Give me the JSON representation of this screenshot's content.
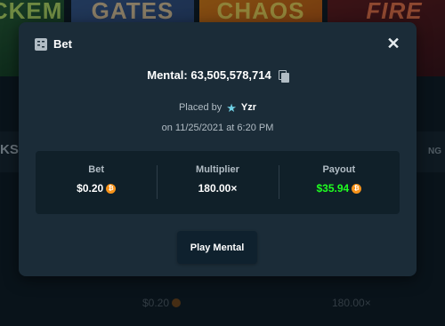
{
  "background": {
    "cards": [
      "ICKEM",
      "GATES",
      "CHAOS",
      "FIRE"
    ],
    "strip_left": "KSA",
    "strip_right": "NG",
    "bottom_row": {
      "bet": "$0.20",
      "multiplier": "180.00×"
    }
  },
  "modal": {
    "title": "Bet",
    "close_icon": "close-icon",
    "bet_id_label": "Mental: 63,505,578,714",
    "placed_by_label": "Placed by",
    "user": "Yzr",
    "date": "on 11/25/2021 at 6:20 PM",
    "stats": [
      {
        "label": "Bet",
        "value": "$0.20",
        "coin": true
      },
      {
        "label": "Multiplier",
        "value": "180.00×",
        "coin": false
      },
      {
        "label": "Payout",
        "value": "$35.94",
        "coin": true
      }
    ],
    "play_button": "Play Mental"
  },
  "colors": {
    "modal_bg": "#1b2c38",
    "panel_bg": "#102029",
    "payout_green": "#1fff20",
    "coin": "#f7931a",
    "muted_text": "#b1bcc4"
  }
}
